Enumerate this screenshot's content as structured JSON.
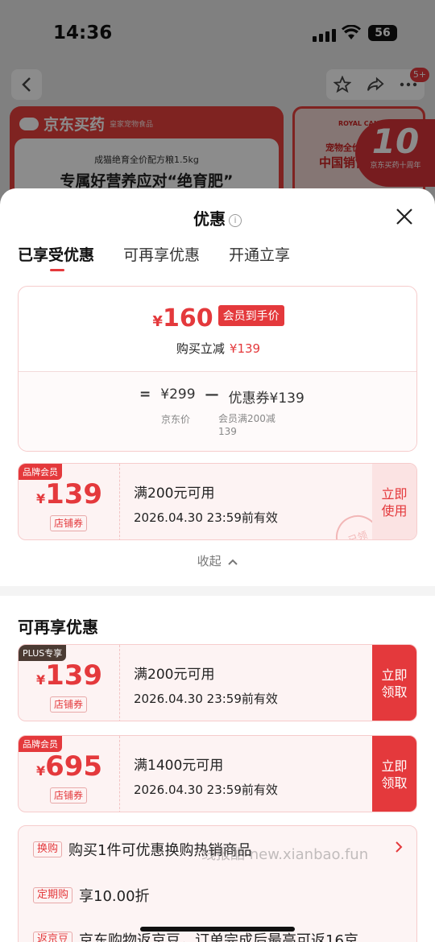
{
  "status_bar": {
    "time": "14:36",
    "battery": "56"
  },
  "top_nav": {
    "badge": "5+"
  },
  "banner_left": {
    "brand": "京东买药",
    "brand_sub": "皇家宠物食品",
    "small": "成猫绝育全价配方粮1.5kg",
    "big": "专属好营养应对“绝育肥”"
  },
  "banner_right": {
    "brand": "ROYAL CANIN",
    "line1": "宠物全价",
    "line2": "中国销售"
  },
  "anniversary": {
    "number": "10",
    "label": "京东买药十周年"
  },
  "sheet": {
    "title": "优惠",
    "info_icon": "i",
    "tabs": [
      {
        "label": "已享受优惠"
      },
      {
        "label": "可再享优惠"
      },
      {
        "label": "开通立享"
      }
    ],
    "summary": {
      "currency": "¥",
      "price": "160",
      "price_tag": "会员到手价",
      "reduce_label": "购买立减",
      "reduce_value": "¥139",
      "eq": "=",
      "jd_price": "¥299",
      "minus": "—",
      "coupon_label": "优惠券¥139",
      "jd_label": "京东价",
      "coupon_cond": "会员满200减139"
    },
    "enjoyed_coupon": {
      "badge": "品牌会员",
      "currency": "¥",
      "amount": "139",
      "type": "店铺券",
      "condition": "满200元可用",
      "validity": "2026.04.30 23:59前有效",
      "action": "立即使用",
      "stamp": "已领"
    },
    "collapse_label": "收起",
    "more_title": "可再享优惠",
    "more_coupons": [
      {
        "badge": "PLUS专享",
        "currency": "¥",
        "amount": "139",
        "type": "店铺券",
        "condition": "满200元可用",
        "validity": "2026.04.30 23:59前有效",
        "action": "立即领取"
      },
      {
        "badge": "品牌会员",
        "currency": "¥",
        "amount": "695",
        "type": "店铺券",
        "condition": "满1400元可用",
        "validity": "2026.04.30 23:59前有效",
        "action": "立即领取"
      }
    ],
    "perks": [
      {
        "tag": "换购",
        "text": "购买1件可优惠换购热销商品"
      },
      {
        "tag": "定期购",
        "text": "享10.00折"
      },
      {
        "tag": "返京豆",
        "text": "京东购物返京豆，订单完成后最高可返16京"
      }
    ],
    "watermark": "线报酷 new.xianbao.fun"
  }
}
